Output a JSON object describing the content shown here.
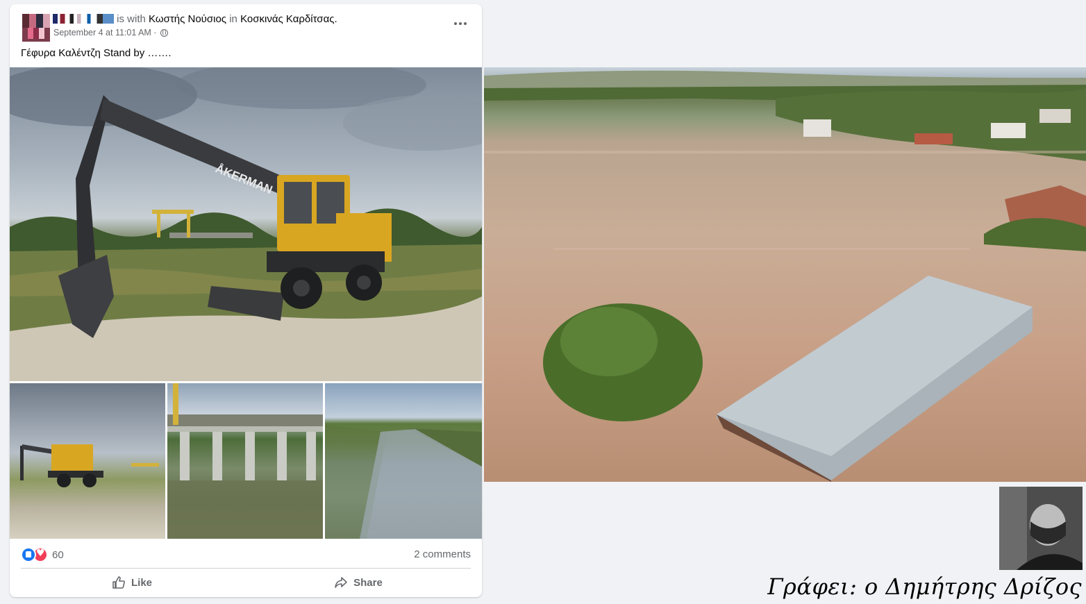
{
  "post": {
    "author_connector": "is with",
    "tagged_person": "Κωστής Νούσιος",
    "location_connector": "in",
    "location": "Κοσκινάς Καρδίτσας",
    "location_suffix": ".",
    "timestamp": "September 4 at 11:01 AM ·",
    "privacy_icon": "globe-icon",
    "more_icon": "more-options-icon",
    "text": "Γέφυρα Καλέντζη Stand by …….",
    "photos": [
      {
        "name": "excavator-main-photo"
      },
      {
        "name": "excavator-thumb-photo"
      },
      {
        "name": "bridge-sluice-photo"
      },
      {
        "name": "river-channel-photo"
      }
    ],
    "machine_brand": "ÅKERMAN",
    "reaction_count": "60",
    "reactions": [
      "like-icon",
      "love-icon"
    ],
    "comments_label": "2 comments",
    "like_label": "Like",
    "share_label": "Share"
  },
  "flood_photo": {
    "name": "flooded-village-photo"
  },
  "caption": {
    "author_text": "Γράφει: ο Δημήτρης Δρίζος"
  },
  "colors": {
    "background": "#f0f2f5",
    "card": "#ffffff",
    "muted_text": "#65676b",
    "like_blue": "#1877f2",
    "love_red": "#f33e58"
  }
}
